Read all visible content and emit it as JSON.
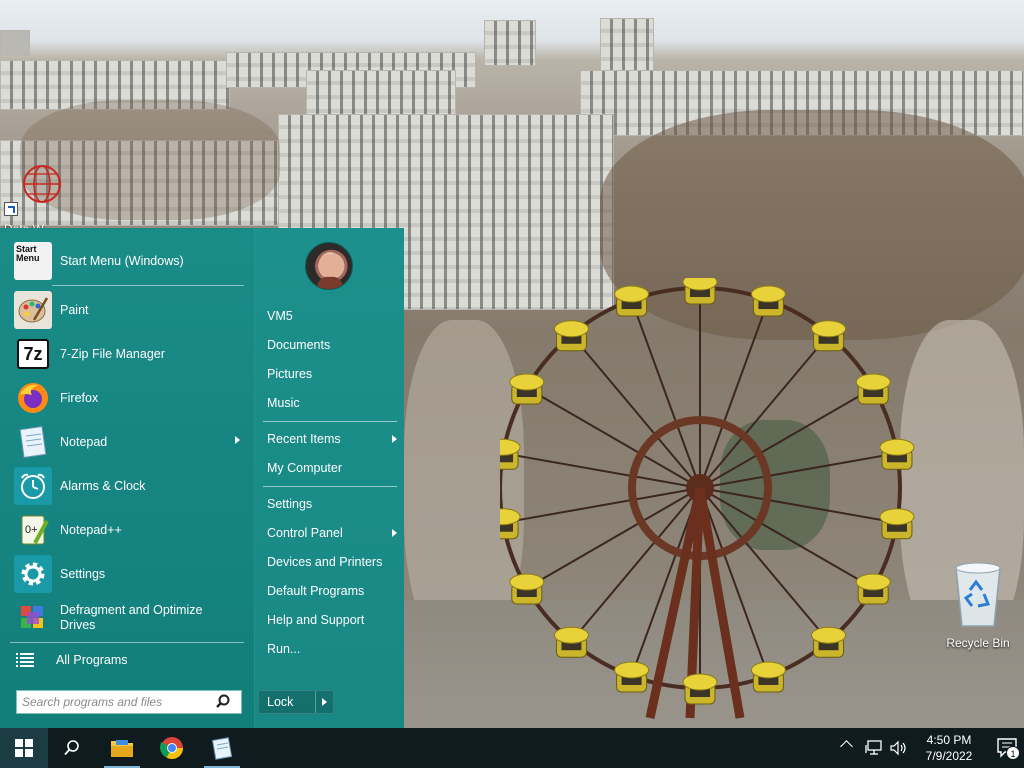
{
  "desktop": {
    "recycle_bin_label": "Recycle Bin",
    "top_left_icon_label": "Data W..."
  },
  "start_menu": {
    "apps": [
      {
        "label": "Start Menu (Windows)",
        "icon": "start-menu-icon",
        "has_submenu": false
      },
      {
        "label": "Paint",
        "icon": "paint-icon",
        "has_submenu": false
      },
      {
        "label": "7-Zip File Manager",
        "icon": "7zip-icon",
        "has_submenu": false
      },
      {
        "label": "Firefox",
        "icon": "firefox-icon",
        "has_submenu": false
      },
      {
        "label": "Notepad",
        "icon": "notepad-icon",
        "has_submenu": true
      },
      {
        "label": "Alarms & Clock",
        "icon": "alarm-clock-icon",
        "has_submenu": false
      },
      {
        "label": "Notepad++",
        "icon": "notepad-plus-plus-icon",
        "has_submenu": false
      },
      {
        "label": "Settings",
        "icon": "settings-gear-icon",
        "has_submenu": false
      },
      {
        "label": "Defragment and Optimize Drives",
        "icon": "defragment-icon",
        "has_submenu": false
      }
    ],
    "start_icon_text": "Start\nMenu",
    "seven_zip_icon_text": "7z",
    "all_programs_label": "All Programs",
    "search_placeholder": "Search programs and files",
    "places": [
      {
        "label": "VM5",
        "has_submenu": false
      },
      {
        "label": "Documents",
        "has_submenu": false
      },
      {
        "label": "Pictures",
        "has_submenu": false
      },
      {
        "label": "Music",
        "has_submenu": false
      },
      {
        "label": "Recent Items",
        "has_submenu": true
      },
      {
        "label": "My Computer",
        "has_submenu": false
      },
      {
        "label": "Settings",
        "has_submenu": false
      },
      {
        "label": "Control Panel",
        "has_submenu": true
      },
      {
        "label": "Devices and Printers",
        "has_submenu": false
      },
      {
        "label": "Default Programs",
        "has_submenu": false
      },
      {
        "label": "Help and Support",
        "has_submenu": false
      },
      {
        "label": "Run...",
        "has_submenu": false
      }
    ],
    "lock_label": "Lock"
  },
  "taskbar": {
    "pinned": [
      "windows-start-icon",
      "search-icon",
      "file-explorer-icon",
      "chrome-icon",
      "notepad-icon"
    ],
    "clock_time": "4:50 PM",
    "clock_date": "7/9/2022",
    "notification_count": "1"
  },
  "colors": {
    "start_menu_teal": "#168581",
    "taskbar": "#101b1f",
    "start_button_bg": "#1c3c44"
  }
}
